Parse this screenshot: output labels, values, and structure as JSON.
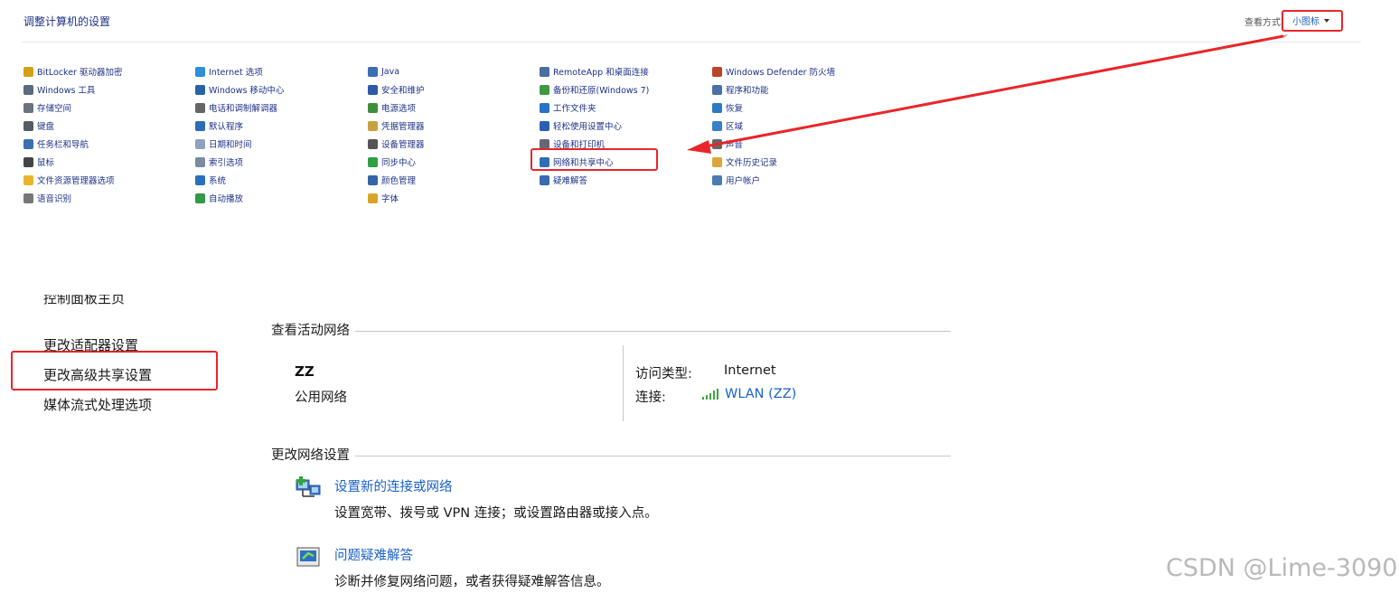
{
  "control_panel": {
    "title": "调整计算机的设置",
    "view_by_label": "查看方式:",
    "view_by_value": "小图标",
    "columns": [
      [
        {
          "label": "BitLocker 驱动器加密",
          "icon": "bitlocker-icon",
          "color": "#d4a01a"
        },
        {
          "label": "Windows 工具",
          "icon": "windows-tools-icon",
          "color": "#5a6b80"
        },
        {
          "label": "存储空间",
          "icon": "storage-spaces-icon",
          "color": "#6b7280"
        },
        {
          "label": "键盘",
          "icon": "keyboard-icon",
          "color": "#555c66"
        },
        {
          "label": "任务栏和导航",
          "icon": "taskbar-icon",
          "color": "#3b6fb0"
        },
        {
          "label": "鼠标",
          "icon": "mouse-icon",
          "color": "#444"
        },
        {
          "label": "文件资源管理器选项",
          "icon": "folder-options-icon",
          "color": "#e8b62c"
        },
        {
          "label": "语音识别",
          "icon": "microphone-icon",
          "color": "#777"
        }
      ],
      [
        {
          "label": "Internet 选项",
          "icon": "internet-options-icon",
          "color": "#2f8fd8"
        },
        {
          "label": "Windows 移动中心",
          "icon": "mobility-center-icon",
          "color": "#2a62a8"
        },
        {
          "label": "电话和调制解调器",
          "icon": "phone-modem-icon",
          "color": "#666"
        },
        {
          "label": "默认程序",
          "icon": "default-programs-icon",
          "color": "#2d6cb8"
        },
        {
          "label": "日期和时间",
          "icon": "clock-icon",
          "color": "#8fa3bf"
        },
        {
          "label": "索引选项",
          "icon": "indexing-icon",
          "color": "#7a8aa0"
        },
        {
          "label": "系统",
          "icon": "system-icon",
          "color": "#2b6fbf"
        },
        {
          "label": "自动播放",
          "icon": "autoplay-icon",
          "color": "#2f9b46"
        }
      ],
      [
        {
          "label": "Java",
          "icon": "java-icon",
          "color": "#3d6db3"
        },
        {
          "label": "安全和维护",
          "icon": "flag-icon",
          "color": "#2c5aa8"
        },
        {
          "label": "电源选项",
          "icon": "power-icon",
          "color": "#3e8e3e"
        },
        {
          "label": "凭据管理器",
          "icon": "credential-icon",
          "color": "#c8a040"
        },
        {
          "label": "设备管理器",
          "icon": "device-manager-icon",
          "color": "#555"
        },
        {
          "label": "同步中心",
          "icon": "sync-icon",
          "color": "#2ea043"
        },
        {
          "label": "颜色管理",
          "icon": "color-management-icon",
          "color": "#3465a4"
        },
        {
          "label": "字体",
          "icon": "fonts-icon",
          "color": "#d8a52a"
        }
      ],
      [
        {
          "label": "RemoteApp 和桌面连接",
          "icon": "remoteapp-icon",
          "color": "#4a6fa0"
        },
        {
          "label": "备份和还原(Windows 7)",
          "icon": "backup-icon",
          "color": "#3f9a3f"
        },
        {
          "label": "工作文件夹",
          "icon": "work-folders-icon",
          "color": "#2a72c8"
        },
        {
          "label": "轻松使用设置中心",
          "icon": "ease-of-access-icon",
          "color": "#2d5fb0"
        },
        {
          "label": "设备和打印机",
          "icon": "printer-icon",
          "color": "#667"
        },
        {
          "label": "网络和共享中心",
          "icon": "network-center-icon",
          "color": "#2f6db5"
        },
        {
          "label": "疑难解答",
          "icon": "troubleshoot-icon",
          "color": "#3a6ab0"
        }
      ],
      [
        {
          "label": "Windows Defender 防火墙",
          "icon": "firewall-icon",
          "color": "#b8452a"
        },
        {
          "label": "程序和功能",
          "icon": "programs-icon",
          "color": "#4a70a8"
        },
        {
          "label": "恢复",
          "icon": "recovery-icon",
          "color": "#2c7ac0"
        },
        {
          "label": "区域",
          "icon": "region-icon",
          "color": "#3b7fc4"
        },
        {
          "label": "声音",
          "icon": "speaker-icon",
          "color": "#666"
        },
        {
          "label": "文件历史记录",
          "icon": "file-history-icon",
          "color": "#d8a93a"
        },
        {
          "label": "用户帐户",
          "icon": "user-accounts-icon",
          "color": "#4d7ab0"
        }
      ]
    ]
  },
  "network_center": {
    "partial_link": "控制面板主页",
    "sidebar": [
      "更改适配器设置",
      "更改高级共享设置",
      "媒体流式处理选项"
    ],
    "active_section_title": "查看活动网络",
    "network_name": "ZZ",
    "network_type": "公用网络",
    "access_type_label": "访问类型:",
    "access_type_value": "Internet",
    "connections_label": "连接:",
    "connection_value": "WLAN (ZZ)",
    "change_section_title": "更改网络设置",
    "tasks": [
      {
        "link": "设置新的连接或网络",
        "desc": "设置宽带、拨号或 VPN 连接；或设置路由器或接入点。",
        "icon": "new-connection-icon"
      },
      {
        "link": "问题疑难解答",
        "desc": "诊断并修复网络问题，或者获得疑难解答信息。",
        "icon": "troubleshoot-icon"
      }
    ]
  },
  "watermark": "CSDN @Lime-3090",
  "colors": {
    "link": "#1a62c8",
    "annotation": "#e8262a",
    "cp_text": "#1e3287"
  }
}
